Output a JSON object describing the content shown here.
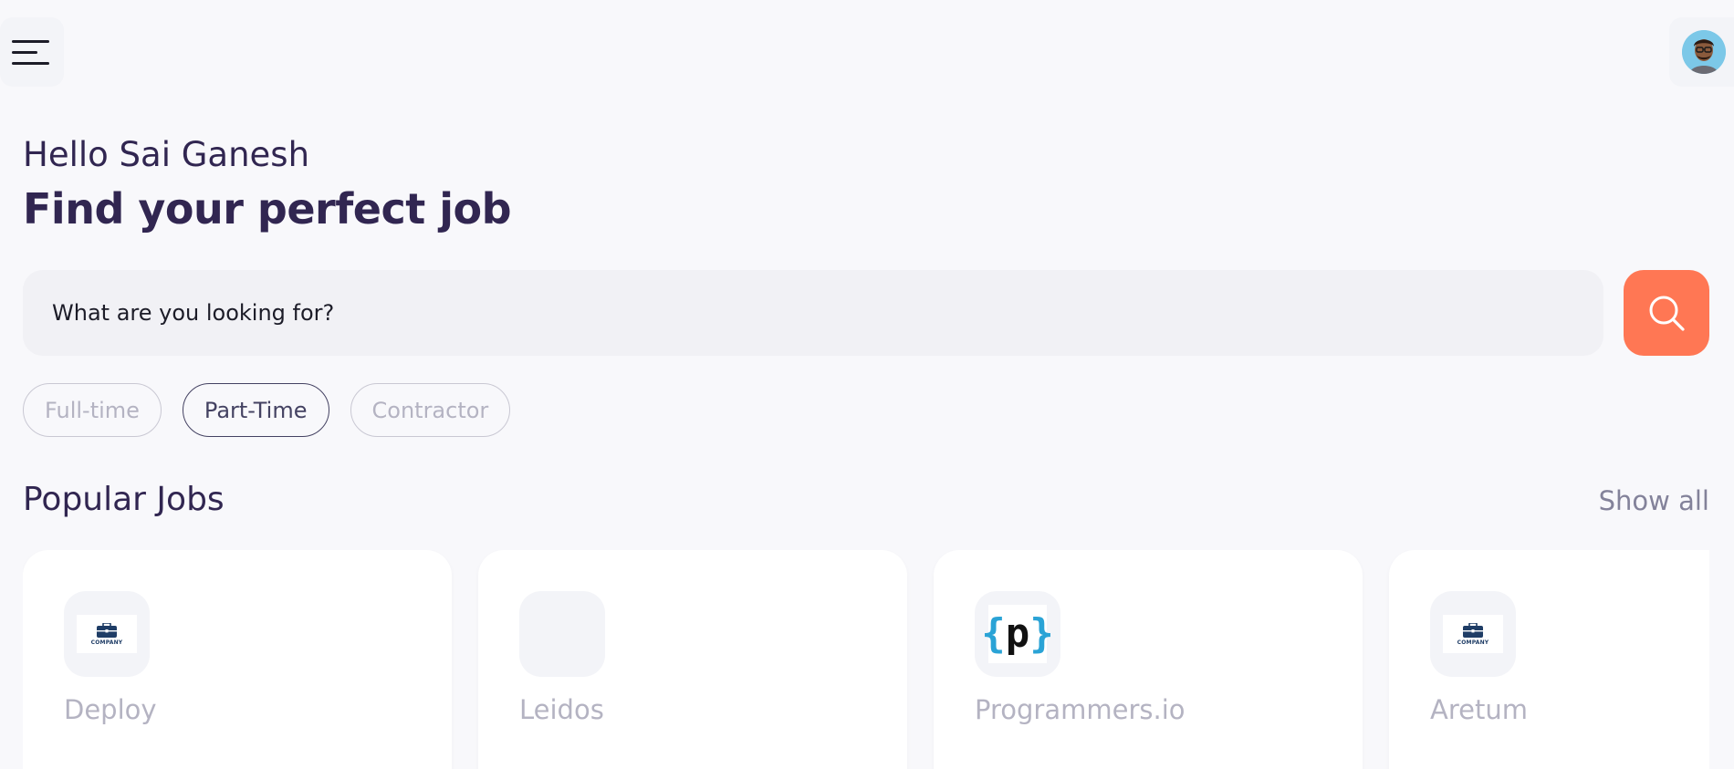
{
  "header": {
    "menu_icon": "hamburger-menu-icon",
    "profile_icon": "avatar"
  },
  "greeting": {
    "hello": "Hello Sai Ganesh",
    "headline": "Find your perfect job"
  },
  "search": {
    "placeholder": "What are you looking for?",
    "value": "",
    "button_icon": "search-icon",
    "button_color": "#FF7754"
  },
  "job_types": [
    {
      "label": "Full-time",
      "selected": false
    },
    {
      "label": "Part-Time",
      "selected": true
    },
    {
      "label": "Contractor",
      "selected": false
    }
  ],
  "popular_jobs": {
    "title": "Popular Jobs",
    "show_all": "Show all",
    "cards": [
      {
        "company": "Deploy",
        "logo": "company-briefcase-logo",
        "logo_text": "COMPANY"
      },
      {
        "company": "Leidos",
        "logo": "blank-logo",
        "logo_text": ""
      },
      {
        "company": "Programmers.io",
        "logo": "programmers-io-logo",
        "logo_text": "{p}"
      },
      {
        "company": "Aretum",
        "logo": "company-briefcase-logo",
        "logo_text": "COMPANY"
      }
    ]
  },
  "colors": {
    "primary": "#312651",
    "tertiary": "#FF7754",
    "gray": "#83829A",
    "light_gray": "#B4B3C2",
    "background": "#F8F8FB"
  }
}
